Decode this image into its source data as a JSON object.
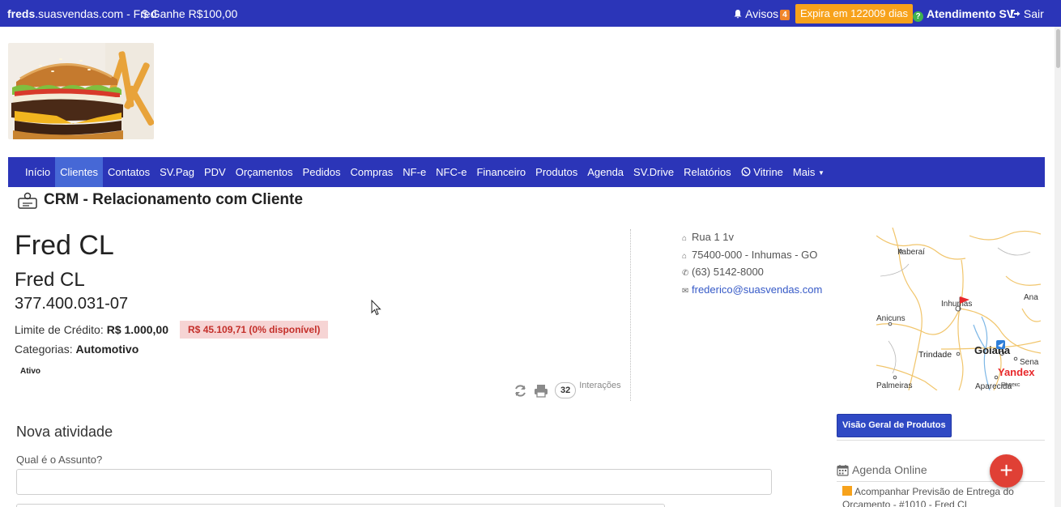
{
  "topbar": {
    "brand_bold": "freds",
    "brand_rest": ".suasvendas.com - Fred",
    "earn_label": "Ganhe R$100,00",
    "avisos_label": "Avisos",
    "avisos_count": "4",
    "expira_label": "Expira em 122009 dias",
    "atendimento_label": "Atendimento SV",
    "sair_label": "Sair"
  },
  "nav": {
    "items": [
      "Início",
      "Clientes",
      "Contatos",
      "SV.Pag",
      "PDV",
      "Orçamentos",
      "Pedidos",
      "Compras",
      "NF-e",
      "NFC-e",
      "Financeiro",
      "Produtos",
      "Agenda",
      "SV.Drive",
      "Relatórios",
      "Vitrine",
      "Mais"
    ],
    "active": "Clientes"
  },
  "page": {
    "title": "CRM - Relacionamento com Cliente"
  },
  "client": {
    "name": "Fred CL",
    "subname": "Fred CL",
    "document": "377.400.031-07",
    "credit_label": "Limite de Crédito:",
    "credit_value": "R$ 1.000,00",
    "credit_badge": "R$ 45.109,71 (0% disponível)",
    "categories_label": "Categorias:",
    "categories_value": "Automotivo",
    "status": "Ativo",
    "interactions_count": "32",
    "interactions_label": "Interações"
  },
  "contact": {
    "address1": "Rua 1 1v",
    "address2": "75400-000 - Inhumas - GO",
    "phone": "(63) 5142-8000",
    "email": "frederico@suasvendas.com"
  },
  "map": {
    "labels": {
      "itaberai": "Itaberaí",
      "inhumas": "Inhumas",
      "anicuns": "Anicuns",
      "trindade": "Trindade",
      "goiania": "Goiana",
      "palmeiras": "Palmeiras",
      "aparecida": "Aparecida",
      "ana": "Ana",
      "sena": "Sena",
      "yandex": "Yandex",
      "yandex_small": "Яндекс"
    }
  },
  "form": {
    "section_title": "Nova atividade",
    "subject_label": "Qual é o Assunto?",
    "subject_value": ""
  },
  "sidebar": {
    "overview_button": "Visão Geral de Produtos",
    "agenda_title": "Agenda Online",
    "agenda_item": "Acompanhar Previsão de Entrega do Orcamento - #1010 - Fred CL"
  },
  "colors": {
    "brand": "#2b35b8",
    "nav_active": "#4668d6",
    "warning": "#f7a21b",
    "danger": "#e04035",
    "success": "#3fb34f"
  }
}
